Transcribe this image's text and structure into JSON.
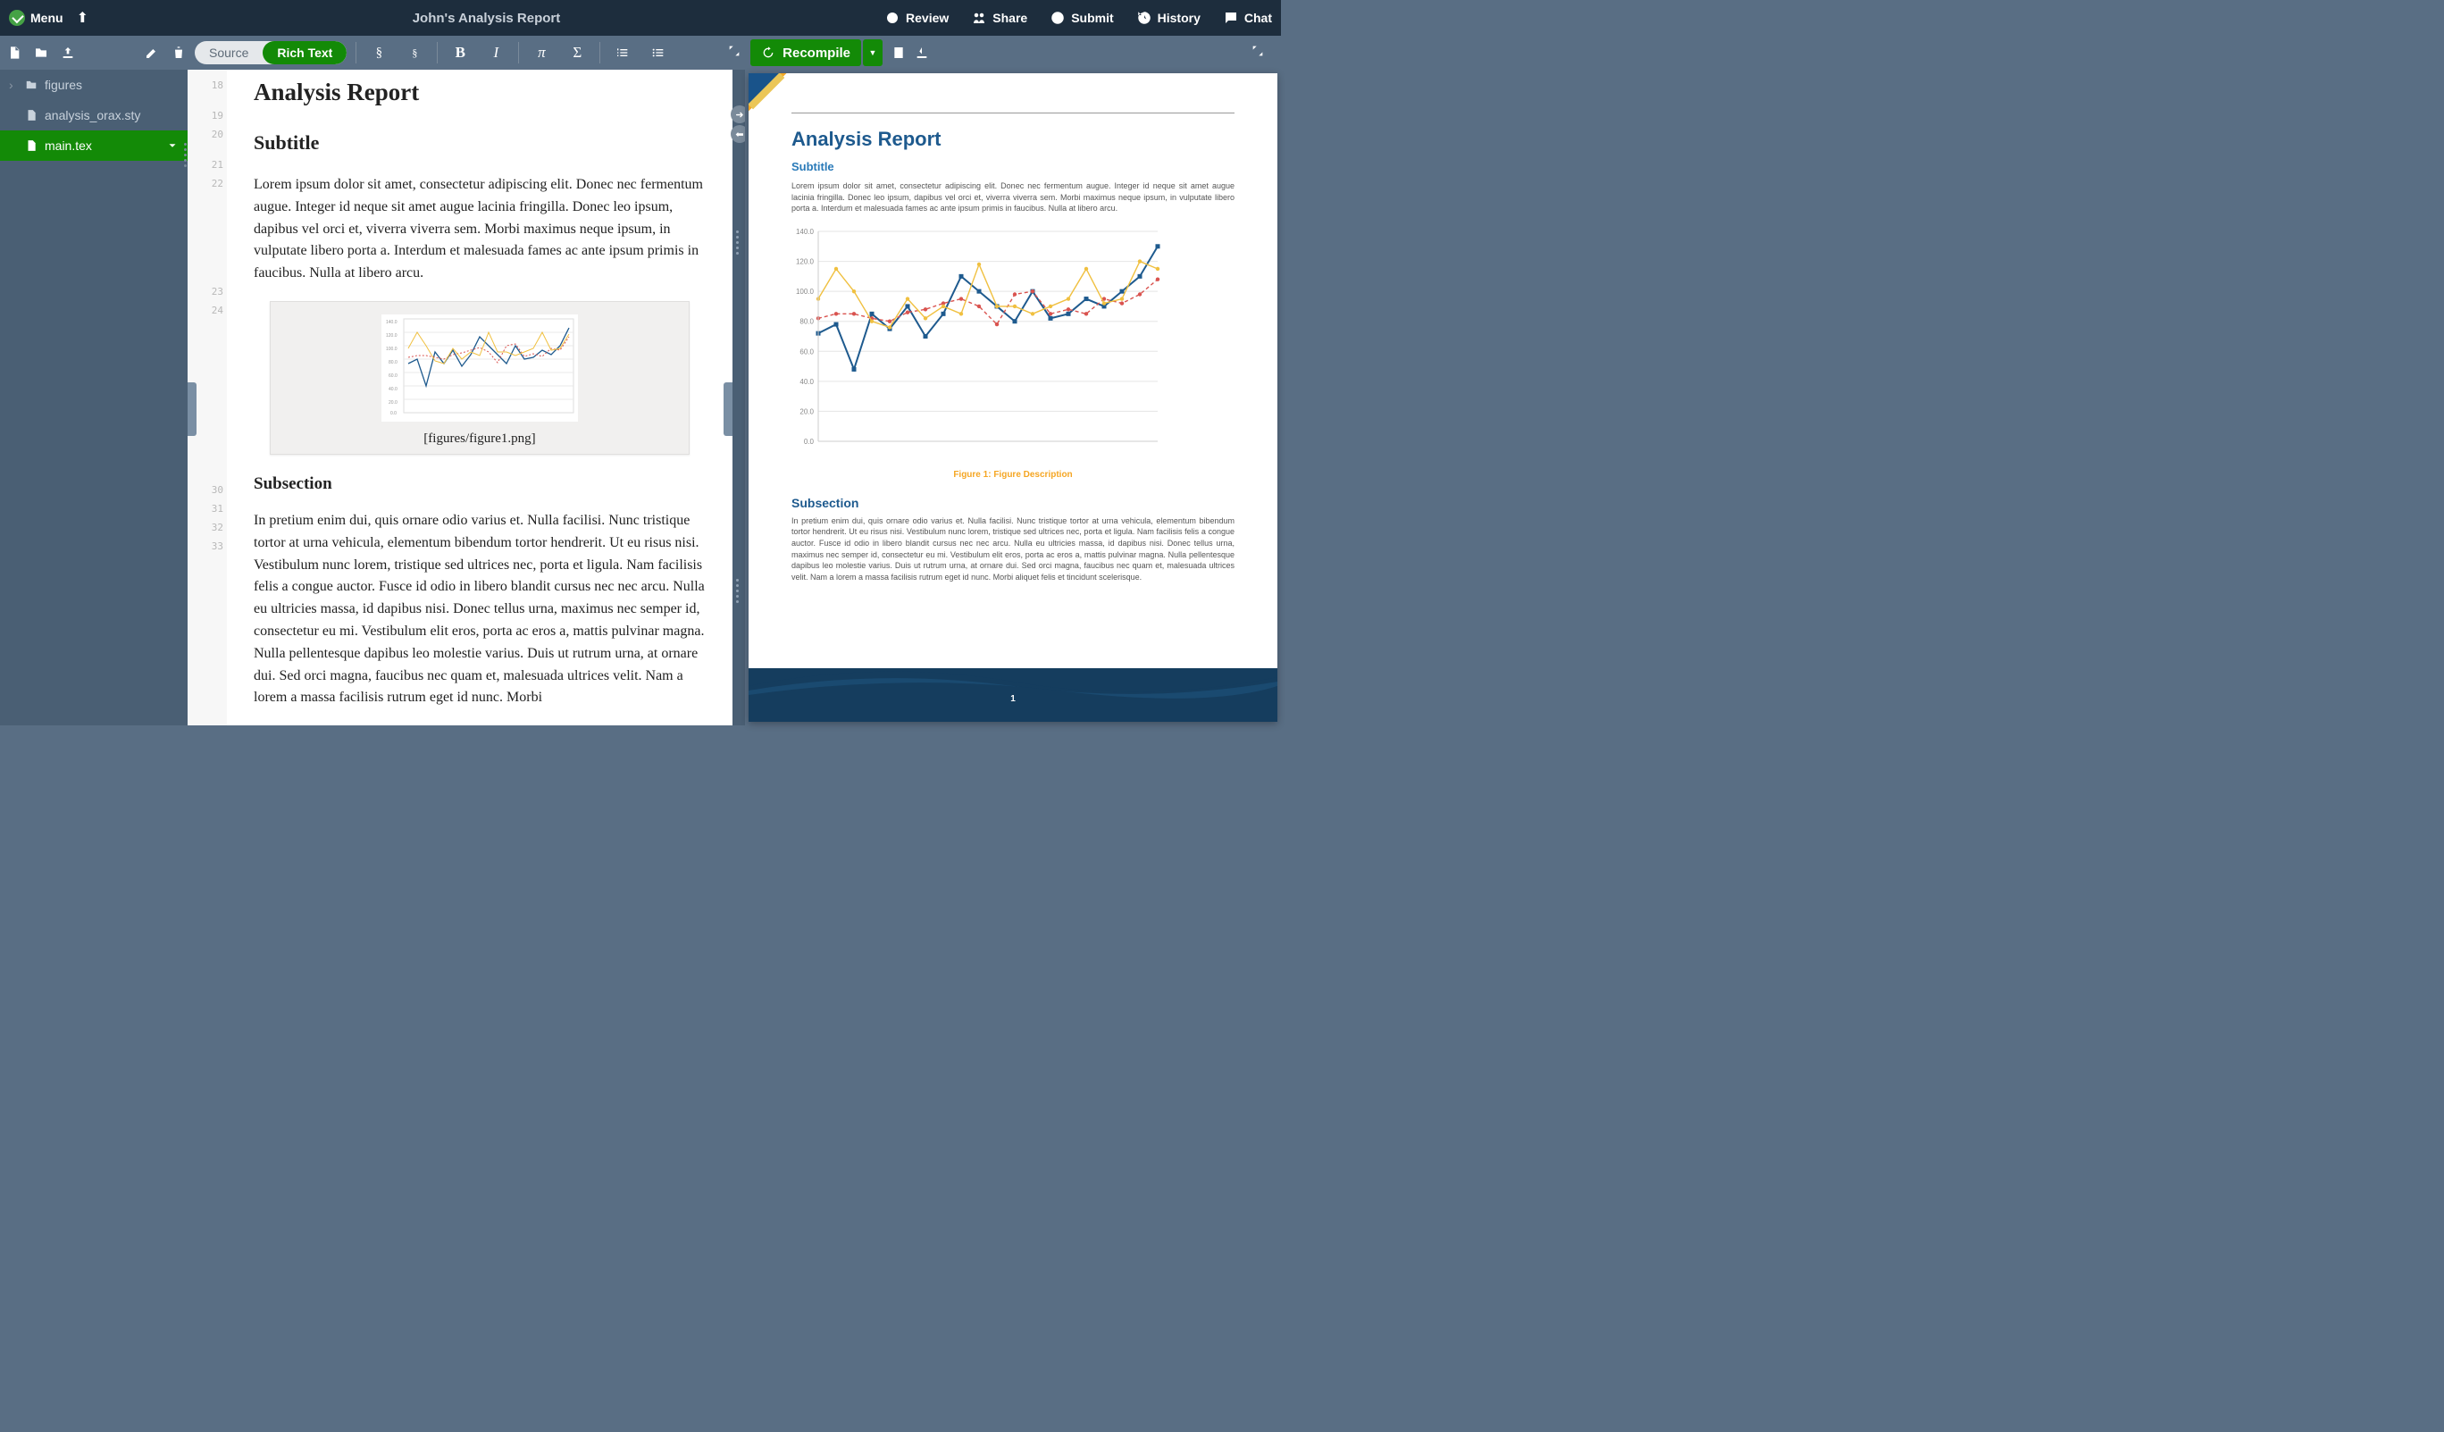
{
  "topbar": {
    "menu": "Menu",
    "title": "John's Analysis Report",
    "review": "Review",
    "share": "Share",
    "submit": "Submit",
    "history": "History",
    "chat": "Chat"
  },
  "toggle": {
    "source": "Source",
    "richtext": "Rich Text"
  },
  "recompile": "Recompile",
  "filetree": {
    "figures": "figures",
    "sty": "analysis_orax.sty",
    "main": "main.tex"
  },
  "gutter": [
    "18",
    "19",
    "20",
    "21",
    "22",
    "23",
    "24",
    "30",
    "31",
    "32",
    "33"
  ],
  "doc": {
    "title": "Analysis Report",
    "subtitle": "Subtitle",
    "para1": "Lorem ipsum dolor sit amet, consectetur adipiscing elit. Donec nec fermentum augue. Integer id neque sit amet augue lacinia fringilla. Donec leo ipsum, dapibus vel orci et, viverra viverra sem. Morbi maximus neque ipsum, in vulputate libero porta a. Interdum et malesuada fames ac ante ipsum primis in faucibus. Nulla at libero arcu.",
    "figcaption": "[figures/figure1.png]",
    "subsection": "Subsection",
    "para2": "In pretium enim dui, quis ornare odio varius et. Nulla facilisi. Nunc tristique tortor at urna vehicula, elementum bibendum tortor hendrerit. Ut eu risus nisi. Vestibulum nunc lorem, tristique sed ultrices nec, porta et ligula. Nam facilisis felis a congue auctor. Fusce id odio in libero blandit cursus nec nec arcu. Nulla eu ultricies massa, id dapibus nisi. Donec tellus urna, maximus nec semper id, consectetur eu mi. Vestibulum elit eros, porta ac eros a, mattis pulvinar magna. Nulla pellentesque dapibus leo molestie varius. Duis ut rutrum urna, at ornare dui. Sed orci magna, faucibus nec quam et, malesuada ultrices velit. Nam a lorem a massa facilisis rutrum eget id nunc. Morbi"
  },
  "pdf": {
    "title": "Analysis Report",
    "subtitle": "Subtitle",
    "body1": "Lorem ipsum dolor sit amet, consectetur adipiscing elit. Donec nec fermentum augue. Integer id neque sit amet augue lacinia fringilla. Donec leo ipsum, dapibus vel orci et, viverra viverra sem. Morbi maximus neque ipsum, in vulputate libero porta a. Interdum et malesuada fames ac ante ipsum primis in faucibus. Nulla at libero arcu.",
    "figcap": "Figure 1: Figure Description",
    "subsection": "Subsection",
    "body2": "In pretium enim dui, quis ornare odio varius et. Nulla facilisi. Nunc tristique tortor at urna vehicula, elementum bibendum tortor hendrerit. Ut eu risus nisi. Vestibulum nunc lorem, tristique sed ultrices nec, porta et ligula. Nam facilisis felis a congue auctor. Fusce id odio in libero blandit cursus nec nec arcu. Nulla eu ultricies massa, id dapibus nisi. Donec tellus urna, maximus nec semper id, consectetur eu mi. Vestibulum elit eros, porta ac eros a, mattis pulvinar magna. Nulla pellentesque dapibus leo molestie varius. Duis ut rutrum urna, at ornare dui. Sed orci magna, faucibus nec quam et, malesuada ultrices velit. Nam a lorem a massa facilisis rutrum eget id nunc. Morbi aliquet felis et tincidunt scelerisque.",
    "pagenum": "1"
  },
  "chart_data": {
    "type": "line",
    "x": [
      1,
      2,
      3,
      4,
      5,
      6,
      7,
      8,
      9,
      10,
      11,
      12,
      13,
      14,
      15,
      16,
      17,
      18,
      19,
      20
    ],
    "ylim": [
      0,
      140
    ],
    "yticks": [
      "0.0",
      "20.0",
      "40.0",
      "60.0",
      "80.0",
      "100.0",
      "120.0",
      "140.0"
    ],
    "series": [
      {
        "name": "blue",
        "color": "#1e5a8e",
        "values": [
          72,
          78,
          48,
          85,
          75,
          90,
          70,
          85,
          110,
          100,
          90,
          80,
          100,
          82,
          85,
          95,
          90,
          100,
          110,
          130
        ]
      },
      {
        "name": "red",
        "color": "#d9534f",
        "values": [
          82,
          85,
          85,
          82,
          80,
          86,
          88,
          92,
          95,
          90,
          78,
          98,
          100,
          85,
          88,
          85,
          95,
          92,
          98,
          108
        ]
      },
      {
        "name": "yellow",
        "color": "#f0c040",
        "values": [
          95,
          115,
          100,
          80,
          76,
          95,
          82,
          90,
          85,
          118,
          90,
          90,
          85,
          90,
          95,
          115,
          92,
          95,
          120,
          115
        ]
      }
    ]
  }
}
